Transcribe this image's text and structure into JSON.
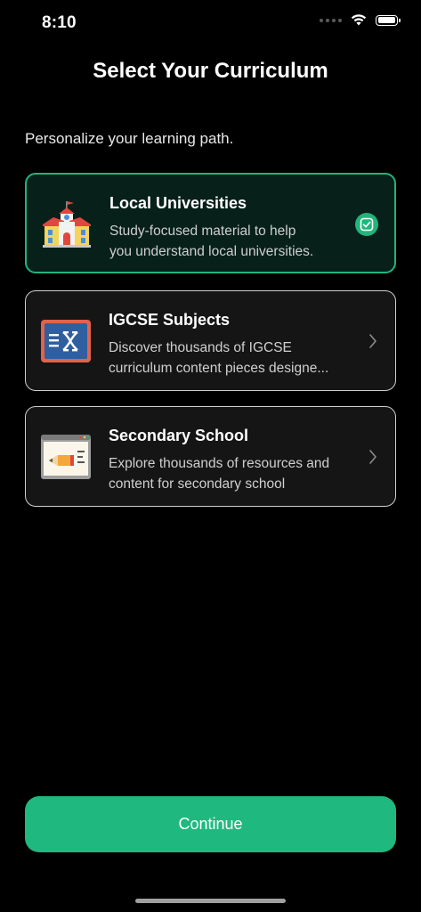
{
  "status_bar": {
    "time": "8:10",
    "battery_level": 1.0
  },
  "header": {
    "title": "Select Your Curriculum"
  },
  "subtitle": "Personalize your learning path.",
  "colors": {
    "accent": "#1fb97f",
    "selected_border": "#22b47b",
    "selected_bg": "#07201a",
    "card_bg": "#151515",
    "card_border": "#cfcfcf"
  },
  "options": [
    {
      "title": "Local Universities",
      "desc_line1": "Study-focused material to help",
      "desc_line2": "you understand local universities.",
      "icon": "school-building-icon",
      "selected": true
    },
    {
      "title": "IGCSE Subjects",
      "desc_line1": "Discover thousands of IGCSE",
      "desc_line2": "curriculum content pieces designe...",
      "icon": "chalkboard-icon",
      "selected": false
    },
    {
      "title": "Secondary School",
      "desc_line1": "Explore thousands of resources and",
      "desc_line2": "content for secondary school",
      "icon": "pencil-whiteboard-icon",
      "selected": false
    }
  ],
  "continue_label": "Continue"
}
